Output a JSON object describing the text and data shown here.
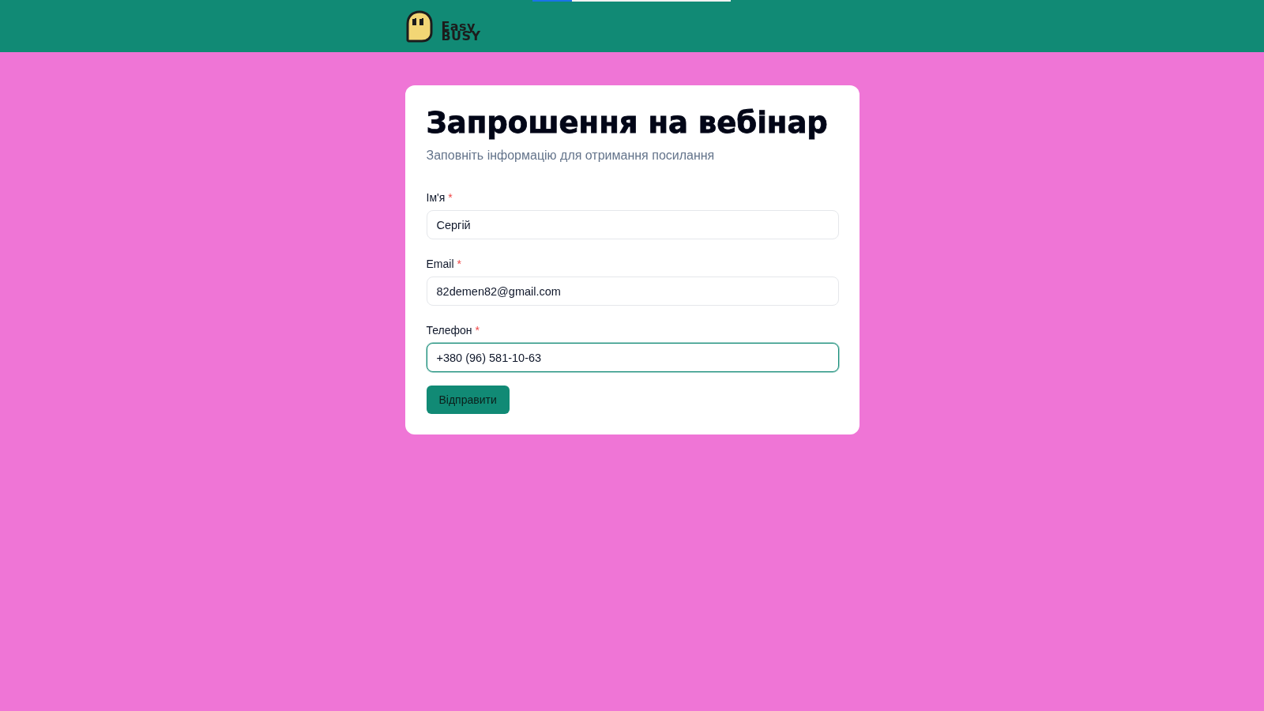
{
  "loading_bar": {
    "level": 0.2
  },
  "header": {
    "logo": {
      "line_1": "Easy",
      "line_2": "BUSY"
    }
  },
  "form": {
    "title": "Запрошення на вебінар",
    "subtitle": "Заповніть інформацію для отримання посилання",
    "fields": [
      {
        "label": "Ім'я",
        "required_mark": "*",
        "value": "Сергій",
        "focused": false
      },
      {
        "label": "Email",
        "required_mark": "*",
        "value": "82demen82@gmail.com",
        "focused": false
      },
      {
        "label": "Телефон",
        "required_mark": "*",
        "value": "+380 (96) 581-10-63",
        "focused": true
      }
    ],
    "submit_button": "Відправити"
  }
}
